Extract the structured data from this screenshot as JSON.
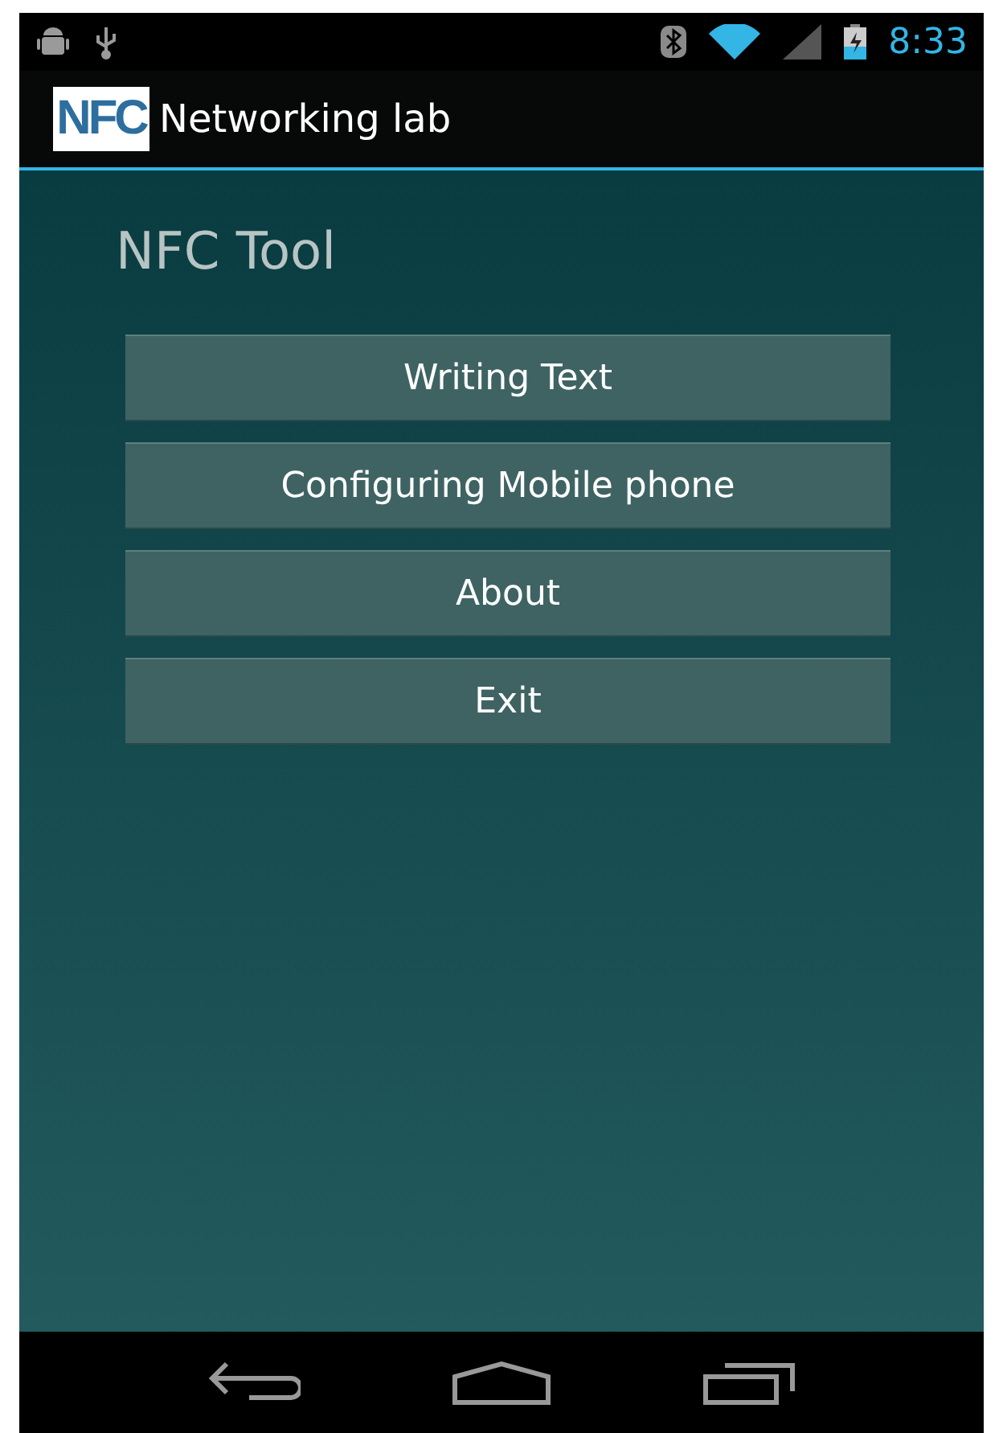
{
  "status_bar": {
    "time": "8:33"
  },
  "action_bar": {
    "logo": "NFC",
    "title": "Networking lab"
  },
  "screen": {
    "heading": "NFC Tool",
    "buttons": [
      {
        "label": "Writing Text"
      },
      {
        "label": "Configuring Mobile phone"
      },
      {
        "label": "About"
      },
      {
        "label": "Exit"
      }
    ]
  }
}
